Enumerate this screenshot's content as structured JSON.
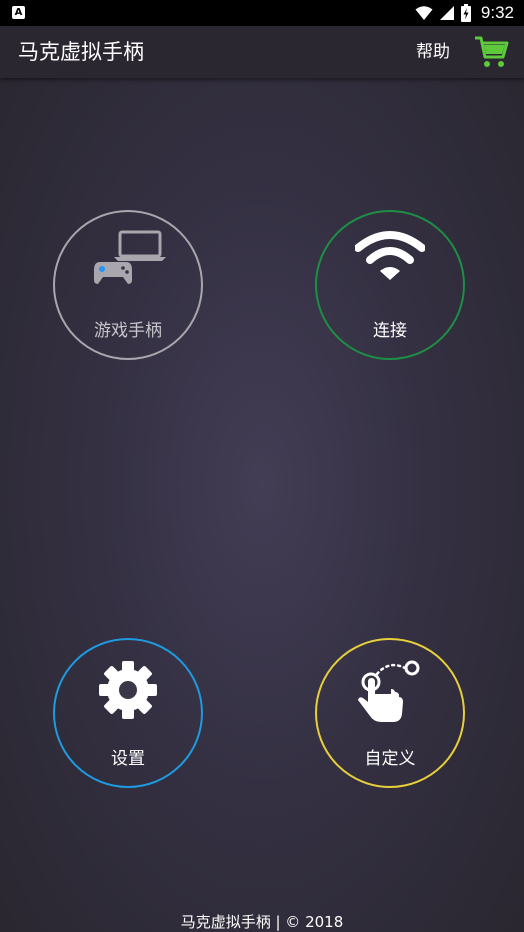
{
  "status_bar": {
    "time": "9:32",
    "app_icon_letter": "A"
  },
  "app_bar": {
    "title": "马克虚拟手柄",
    "help_label": "帮助",
    "cart_color": "#5ec93a"
  },
  "buttons": {
    "gamepad_label": "游戏手柄",
    "connect_label": "连接",
    "settings_label": "设置",
    "custom_label": "自定义"
  },
  "colors": {
    "gamepad_ring": "#a9a6ad",
    "connect_ring": "#1d8f45",
    "settings_ring": "#1e9be0",
    "custom_ring": "#e7cf3c"
  },
  "footer": {
    "text": "马克虚拟手柄 | © 2018"
  }
}
